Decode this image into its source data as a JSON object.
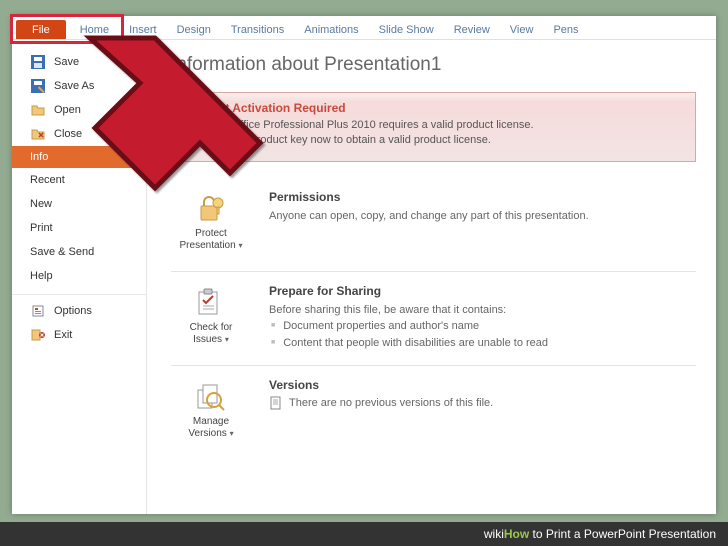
{
  "ribbon": {
    "file": "File",
    "tabs": [
      "Home",
      "Insert",
      "Design",
      "Transitions",
      "Animations",
      "Slide Show",
      "Review",
      "View",
      "Pens"
    ]
  },
  "leftnav": {
    "save": "Save",
    "save_as": "Save As",
    "open": "Open",
    "close": "Close",
    "info": "Info",
    "recent": "Recent",
    "new": "New",
    "print": "Print",
    "save_send": "Save & Send",
    "help": "Help",
    "options": "Options",
    "exit": "Exit"
  },
  "page": {
    "title": "Information about Presentation1",
    "alert": {
      "heading": "Product Activation Required",
      "line1": "Microsoft Office Professional Plus 2010 requires a valid product license.",
      "line2": "Activate your product key now to obtain a valid product license."
    },
    "permissions": {
      "tile": "Protect Presentation",
      "heading": "Permissions",
      "body": "Anyone can open, copy, and change any part of this presentation."
    },
    "prepare": {
      "tile": "Check for Issues",
      "heading": "Prepare for Sharing",
      "lead": "Before sharing this file, be aware that it contains:",
      "bullet1": "Document properties and author's name",
      "bullet2": "Content that people with disabilities are unable to read"
    },
    "versions": {
      "tile": "Manage Versions",
      "heading": "Versions",
      "body": "There are no previous versions of this file."
    }
  },
  "caption": {
    "brand_prefix": "wiki",
    "brand_accent": "How",
    "rest": " to Print a PowerPoint Presentation"
  }
}
